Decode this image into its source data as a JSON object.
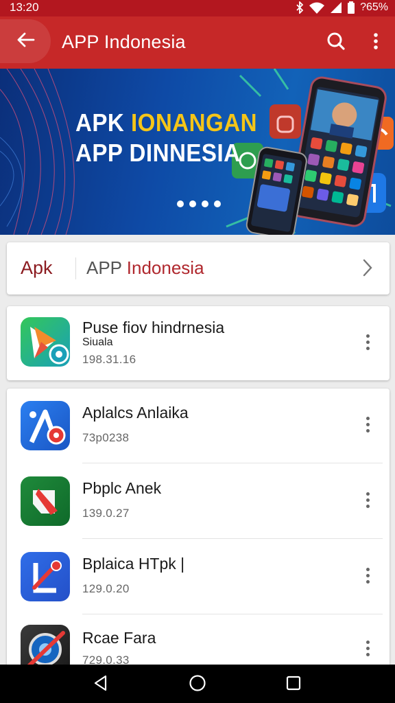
{
  "status_bar": {
    "time": "13:20",
    "battery_text": "?65%",
    "icons": [
      "bluetooth-icon",
      "wifi-icon",
      "signal-icon",
      "battery-icon"
    ]
  },
  "app_bar": {
    "title": "APP Indonesia",
    "icons": [
      "back-arrow-icon",
      "search-icon",
      "more-vert-icon"
    ]
  },
  "banner": {
    "line1_white": "APK",
    "line1_accent": "IONANGAN",
    "line2": "APP DINNESIA",
    "page_count": 4
  },
  "category_tab": {
    "short": "Apk",
    "label_prefix": "APP ",
    "label_highlight": "Indonesia"
  },
  "featured_app": {
    "name": "Puse fiov hindrnesia",
    "subtitle": "Siuala",
    "meta": "198.31.16"
  },
  "apps": [
    {
      "name": "Aplalcs Anlaika",
      "meta": "73p0238"
    },
    {
      "name": "Pbplc Anek",
      "meta": "139.0.27"
    },
    {
      "name": "Bplaica HTpk |",
      "meta": "129.0.20"
    },
    {
      "name": "Rcae Fara",
      "meta": "729.0.33"
    }
  ],
  "colors": {
    "primary": "#c62828",
    "status_bar": "#b3171f",
    "accent_yellow": "#f5c518",
    "background": "#ececec"
  }
}
